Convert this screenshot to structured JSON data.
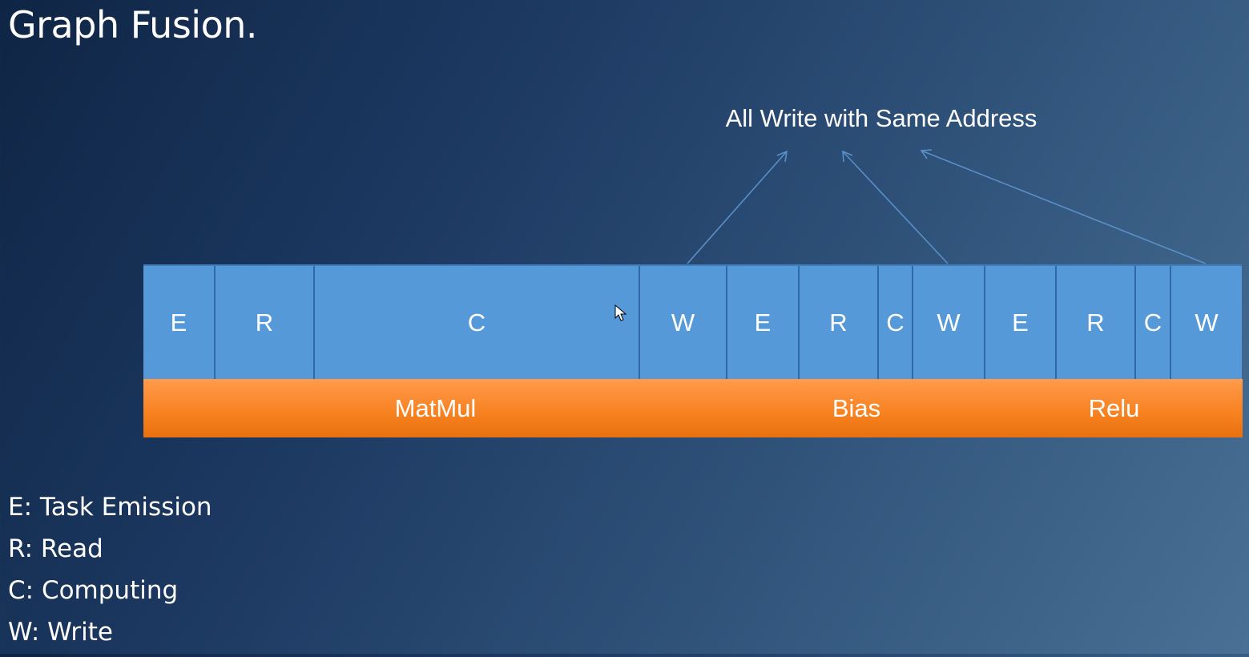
{
  "title": "Graph Fusion.",
  "annotation": "All Write with Same Address",
  "tasks": [
    {
      "label": "E"
    },
    {
      "label": "R"
    },
    {
      "label": "C"
    },
    {
      "label": "W"
    },
    {
      "label": "E"
    },
    {
      "label": "R"
    },
    {
      "label": "C"
    },
    {
      "label": "W"
    },
    {
      "label": "E"
    },
    {
      "label": "R"
    },
    {
      "label": "C"
    },
    {
      "label": "W"
    }
  ],
  "operations": [
    {
      "label": "MatMul"
    },
    {
      "label": "Bias"
    },
    {
      "label": "Relu"
    }
  ],
  "legend": [
    {
      "text": "E: Task Emission"
    },
    {
      "text": "R: Read"
    },
    {
      "text": "C: Computing"
    },
    {
      "text": "W: Write"
    }
  ],
  "colors": {
    "task_fill": "#5699d8",
    "op_fill": "#f7811f",
    "arrow": "#5a8fc8"
  }
}
